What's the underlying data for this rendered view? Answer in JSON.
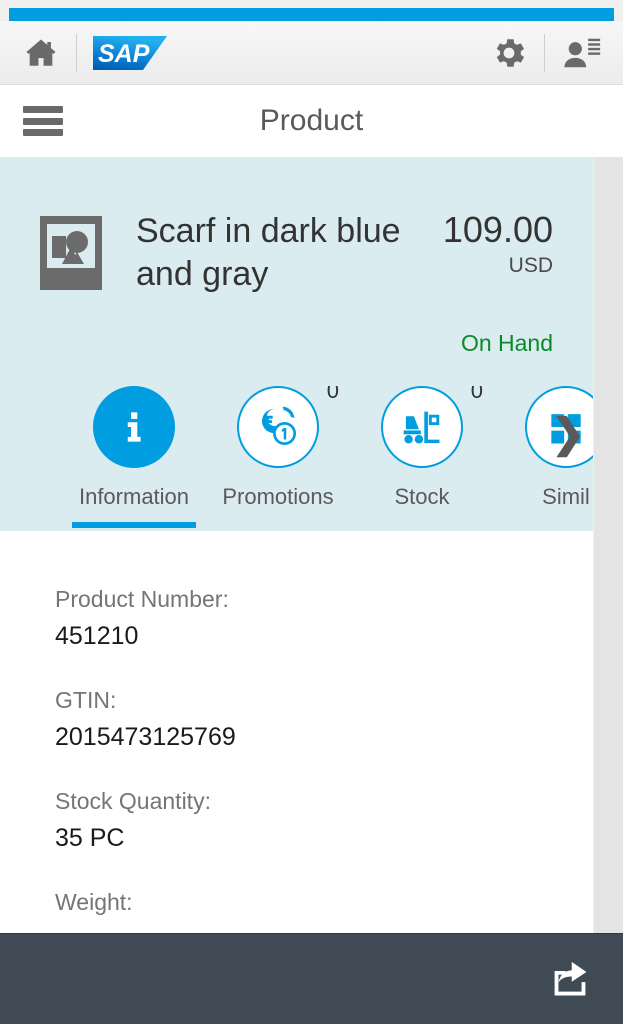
{
  "shell": {
    "home_icon": "home-icon",
    "logo_text": "SAP",
    "gear_icon": "gear-icon",
    "user_icon": "user-icon"
  },
  "page": {
    "menu_icon": "hamburger-menu-icon",
    "title": "Product"
  },
  "object_header": {
    "thumbnail_icon": "image-placeholder-icon",
    "title": "Scarf in dark blue and gray",
    "price": "109.00",
    "currency": "USD",
    "status": "On Hand",
    "status_color": "#0a8a2a"
  },
  "tabs": {
    "next_icon": "chevron-right-icon",
    "items": [
      {
        "label": "Information",
        "icon": "info-icon",
        "count": "",
        "active": true
      },
      {
        "label": "Promotions",
        "icon": "promotions-coins-icon",
        "count": "0",
        "active": false
      },
      {
        "label": "Stock",
        "icon": "forklift-icon",
        "count": "0",
        "active": false
      },
      {
        "label": "Simil",
        "icon": "similar-products-icon",
        "count": "",
        "active": false
      }
    ]
  },
  "details": {
    "fields": [
      {
        "label": "Product Number:",
        "value": "451210"
      },
      {
        "label": "GTIN:",
        "value": "2015473125769"
      },
      {
        "label": "Stock Quantity:",
        "value": "35 PC"
      },
      {
        "label": "Weight:",
        "value": ""
      }
    ]
  },
  "footer": {
    "share_icon": "share-icon"
  },
  "colors": {
    "accent": "#009de0",
    "header_bg": "#dbecf1",
    "footer_bg": "#3f4a54",
    "positive": "#0a8a2a"
  }
}
